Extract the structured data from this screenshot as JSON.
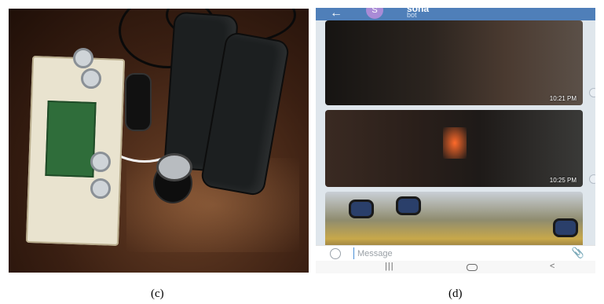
{
  "panel_c": {
    "caption": "(c)"
  },
  "panel_d": {
    "caption": "(d)",
    "chat": {
      "avatar_letter": "S",
      "name": "sona",
      "subtitle": "bot"
    },
    "messages": [
      {
        "time": "10:21 PM"
      },
      {
        "time": "10:25 PM"
      },
      {
        "time": ""
      }
    ],
    "input": {
      "placeholder": "Message"
    },
    "icons": {
      "back": "arrow-left-icon",
      "emoji": "emoji-icon",
      "attach": "paperclip-icon"
    },
    "colors": {
      "header": "#4f7fb9",
      "avatar": "#a98bd6"
    }
  }
}
